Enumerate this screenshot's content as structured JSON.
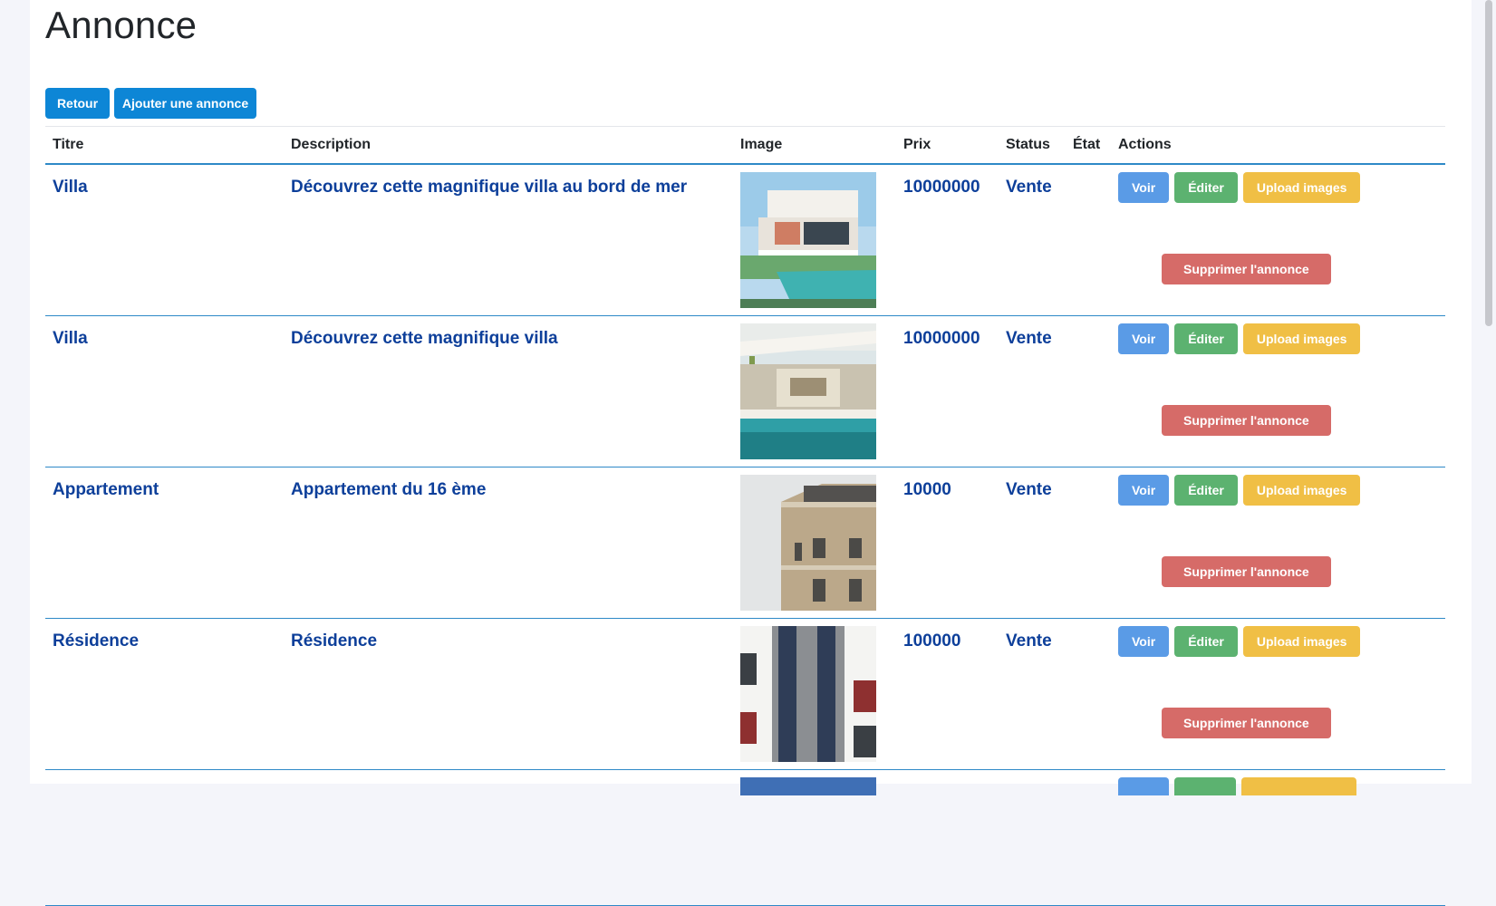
{
  "page": {
    "title": "Annonce",
    "buttons": {
      "back": "Retour",
      "add": "Ajouter une annonce"
    }
  },
  "table": {
    "headers": {
      "title": "Titre",
      "description": "Description",
      "image": "Image",
      "price": "Prix",
      "status": "Status",
      "state": "État",
      "actions": "Actions"
    },
    "action_labels": {
      "view": "Voir",
      "edit": "Éditer",
      "upload": "Upload images",
      "delete": "Supprimer l'annonce"
    },
    "rows": [
      {
        "title": "Villa",
        "description": "Découvrez cette magnifique villa au bord de mer",
        "price": "10000000",
        "status": "Vente",
        "state": "",
        "image": "modern-villa-pool-photo"
      },
      {
        "title": "Villa",
        "description": "Découvrez cette magnifique villa",
        "price": "10000000",
        "status": "Vente",
        "state": "",
        "image": "villa-glass-pool-photo"
      },
      {
        "title": "Appartement",
        "description": "Appartement du 16 ème",
        "price": "10000",
        "status": "Vente",
        "state": "",
        "image": "haussmann-building-photo"
      },
      {
        "title": "Résidence",
        "description": "Résidence",
        "price": "100000",
        "status": "Vente",
        "state": "",
        "image": "residence-facade-photo"
      }
    ]
  },
  "colors": {
    "primary": "#0d86d6",
    "view": "#5a9be6",
    "edit": "#5cb270",
    "upload": "#f0bf45",
    "delete": "#d66b68",
    "row_text": "#0d3f9a",
    "row_border": "#2e89c7"
  }
}
